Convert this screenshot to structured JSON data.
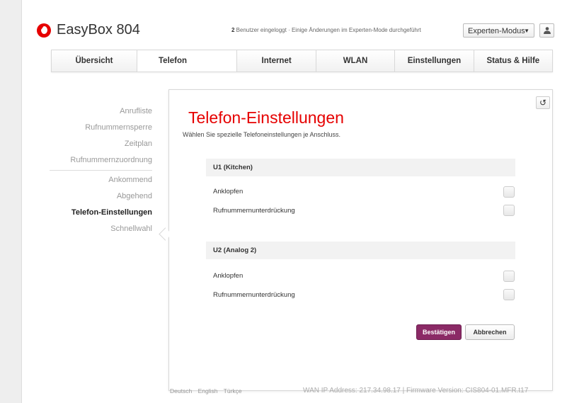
{
  "header": {
    "brand": "EasyBox 804",
    "users_count": "2",
    "users_text": " Benutzer eingeloggt · Einige Änderungen im Experten-Mode durchgeführt",
    "mode_selected": "Experten-Modus"
  },
  "nav": {
    "tabs": [
      "Übersicht",
      "Telefon",
      "Internet",
      "WLAN",
      "Einstellungen",
      "Status & Hilfe"
    ],
    "active": "Telefon"
  },
  "sidebar": {
    "items": [
      "Anrufliste",
      "Rufnummernsperre",
      "Zeitplan",
      "Rufnummernzuordnung",
      "Ankommend",
      "Abgehend",
      "Telefon-Einstellungen",
      "Schnellwahl"
    ],
    "active": "Telefon-Einstellungen"
  },
  "main": {
    "title": "Telefon-Einstellungen",
    "subtitle": "Wählen Sie spezielle Telefoneinstellungen je Anschluss.",
    "sections": [
      {
        "heading": "U1 (Kitchen)",
        "rows": [
          "Anklopfen",
          "Rufnummernunterdrückung"
        ]
      },
      {
        "heading": "U2 (Analog 2)",
        "rows": [
          "Anklopfen",
          "Rufnummernunterdrückung"
        ]
      }
    ],
    "confirm_label": "Bestätigen",
    "cancel_label": "Abbrechen"
  },
  "footer": {
    "languages": [
      "Deutsch",
      "English",
      "Türkçe"
    ],
    "info": "WAN IP Address: 217.34.98.17 | Firmware Version: CIS804-01.MFR.t17"
  },
  "colors": {
    "brand_red": "#e60000",
    "confirm_button": "#8b2a66"
  },
  "icons": {
    "user": "user-icon",
    "reset": "reset-icon",
    "logo": "vodafone-logo-icon"
  }
}
